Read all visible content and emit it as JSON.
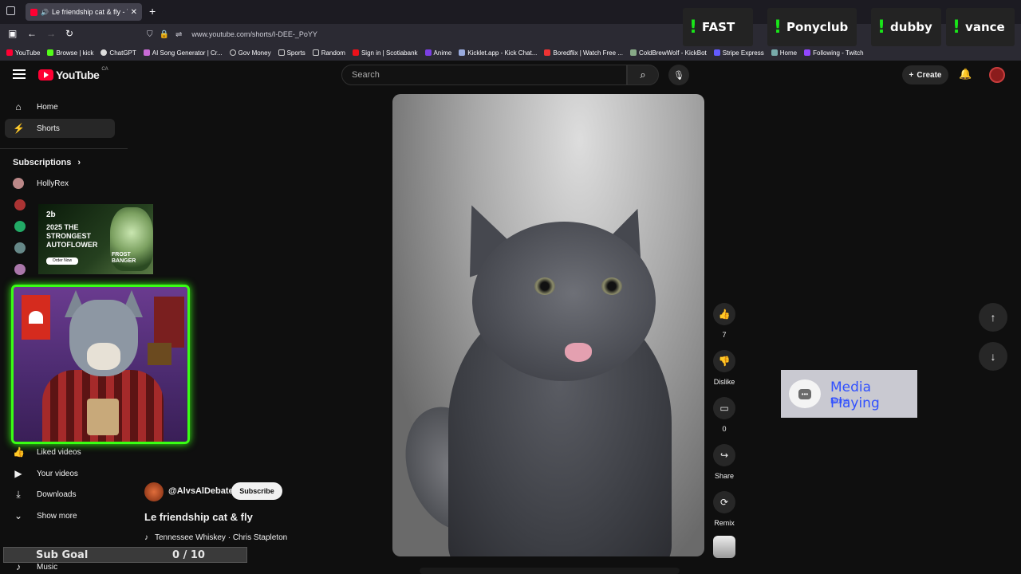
{
  "browser": {
    "tab_title": "Le friendship cat & fly - YouTube",
    "url": "www.youtube.com/shorts/I-DEE-_PoYY",
    "bookmarks": [
      "YouTube",
      "Browse | kick",
      "ChatGPT",
      "AI Song Generator | Cr...",
      "Gov Money",
      "Sports",
      "Random",
      "Sign in | Scotiabank",
      "Anime",
      "Kicklet.app - Kick Chat...",
      "Boredflix | Watch Free ...",
      "ColdBrewWolf - KickBot",
      "Stripe Express",
      "Home",
      "Following - Twitch"
    ]
  },
  "overlay_commands": [
    "FAST",
    "Ponyclub",
    "dubby",
    "vance"
  ],
  "youtube": {
    "logo": "YouTube",
    "country": "CA",
    "search_placeholder": "Search",
    "create_label": "Create"
  },
  "sidebar": {
    "home": "Home",
    "shorts": "Shorts",
    "subscriptions_title": "Subscriptions",
    "sub_first": "HollyRex",
    "liked": "Liked videos",
    "your_videos": "Your videos",
    "downloads": "Downloads",
    "show_more": "Show more",
    "music": "Music"
  },
  "ad": {
    "brand": "2b",
    "headline": "2025 THE STRONGEST AUTOFLOWER",
    "button": "Order Now",
    "product": "FROST BANGER"
  },
  "actions": {
    "likes": "7",
    "dislike": "Dislike",
    "comments": "0",
    "share": "Share",
    "remix": "Remix"
  },
  "media_widget": {
    "title": "Media Playing",
    "value": "None"
  },
  "video": {
    "channel": "@AlvsAlDebate",
    "subscribe": "Subscribe",
    "title": "Le friendship cat & fly",
    "song": "Tennessee Whiskey · Chris Stapleton"
  },
  "sub_goal": {
    "label": "Sub Goal",
    "value": "0 / 10"
  }
}
